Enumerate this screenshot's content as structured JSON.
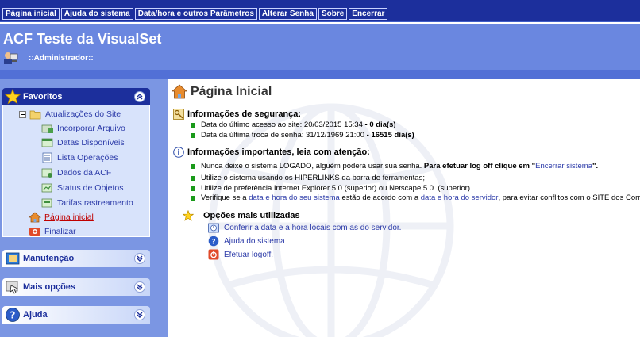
{
  "top_menu": {
    "items": [
      "Página inicial",
      "Ajuda do sistema",
      "Data/hora e outros Parâmetros",
      "Alterar Senha",
      "Sobre",
      "Encerrar"
    ]
  },
  "header": {
    "title": "ACF Teste da VisualSet",
    "user": "::Administrador::"
  },
  "sidebar": {
    "favoritos": {
      "title": "Favoritos",
      "group_label": "Atualizações do Site",
      "items": [
        "Incorporar Arquivo",
        "Datas Disponíveis",
        "Lista Operações",
        "Dados da ACF",
        "Status de Objetos",
        "Tarifas rastreamento"
      ],
      "home_label": "Página inicial",
      "finish_label": "Finalizar"
    },
    "panels": [
      {
        "title": "Manutenção"
      },
      {
        "title": "Mais opções"
      },
      {
        "title": "Ajuda"
      }
    ]
  },
  "main": {
    "page_title": "Página Inicial",
    "security": {
      "title": "Informações de segurança:",
      "last_access_label": "Data do último acesso ao site:",
      "last_access_value": "20/03/2015 15:34",
      "last_access_sep": " - ",
      "last_access_days": "0 dia(s)",
      "last_pw_label": "Data da última troca de senha:",
      "last_pw_value": "31/12/1969 21:00",
      "last_pw_sep": " - ",
      "last_pw_days": "16515 dia(s)"
    },
    "important": {
      "title": "Informações importantes, leia com atenção:",
      "b1_text": "Nunca deixe o sistema LOGADO, alguém poderá usar sua senha.",
      "b1_bold": " Para efetuar log off clique em \"",
      "b1_link": "Encerrar sistema",
      "b1_end": "\".",
      "b2": "Utilize o sistema usando os HIPERLINKS da barra de ferramentas;",
      "b3": "Utilize de preferência Internet Explorer 5.0 (superior) ou Netscape 5.0  (superior)",
      "b4_pre": "Verifique se a ",
      "b4_link1": "data e hora do seu sistema",
      "b4_mid": " estão de acordo com a ",
      "b4_link2": "data e hora do servidor",
      "b4_end": ", para evitar conflitos com o SITE dos Correios."
    },
    "options": {
      "title": "Opções mais utilizadas",
      "items": [
        "Conferir a data e a hora locais com as do servidor.",
        "Ajuda do sistema",
        "Efetuar logoff."
      ]
    }
  }
}
